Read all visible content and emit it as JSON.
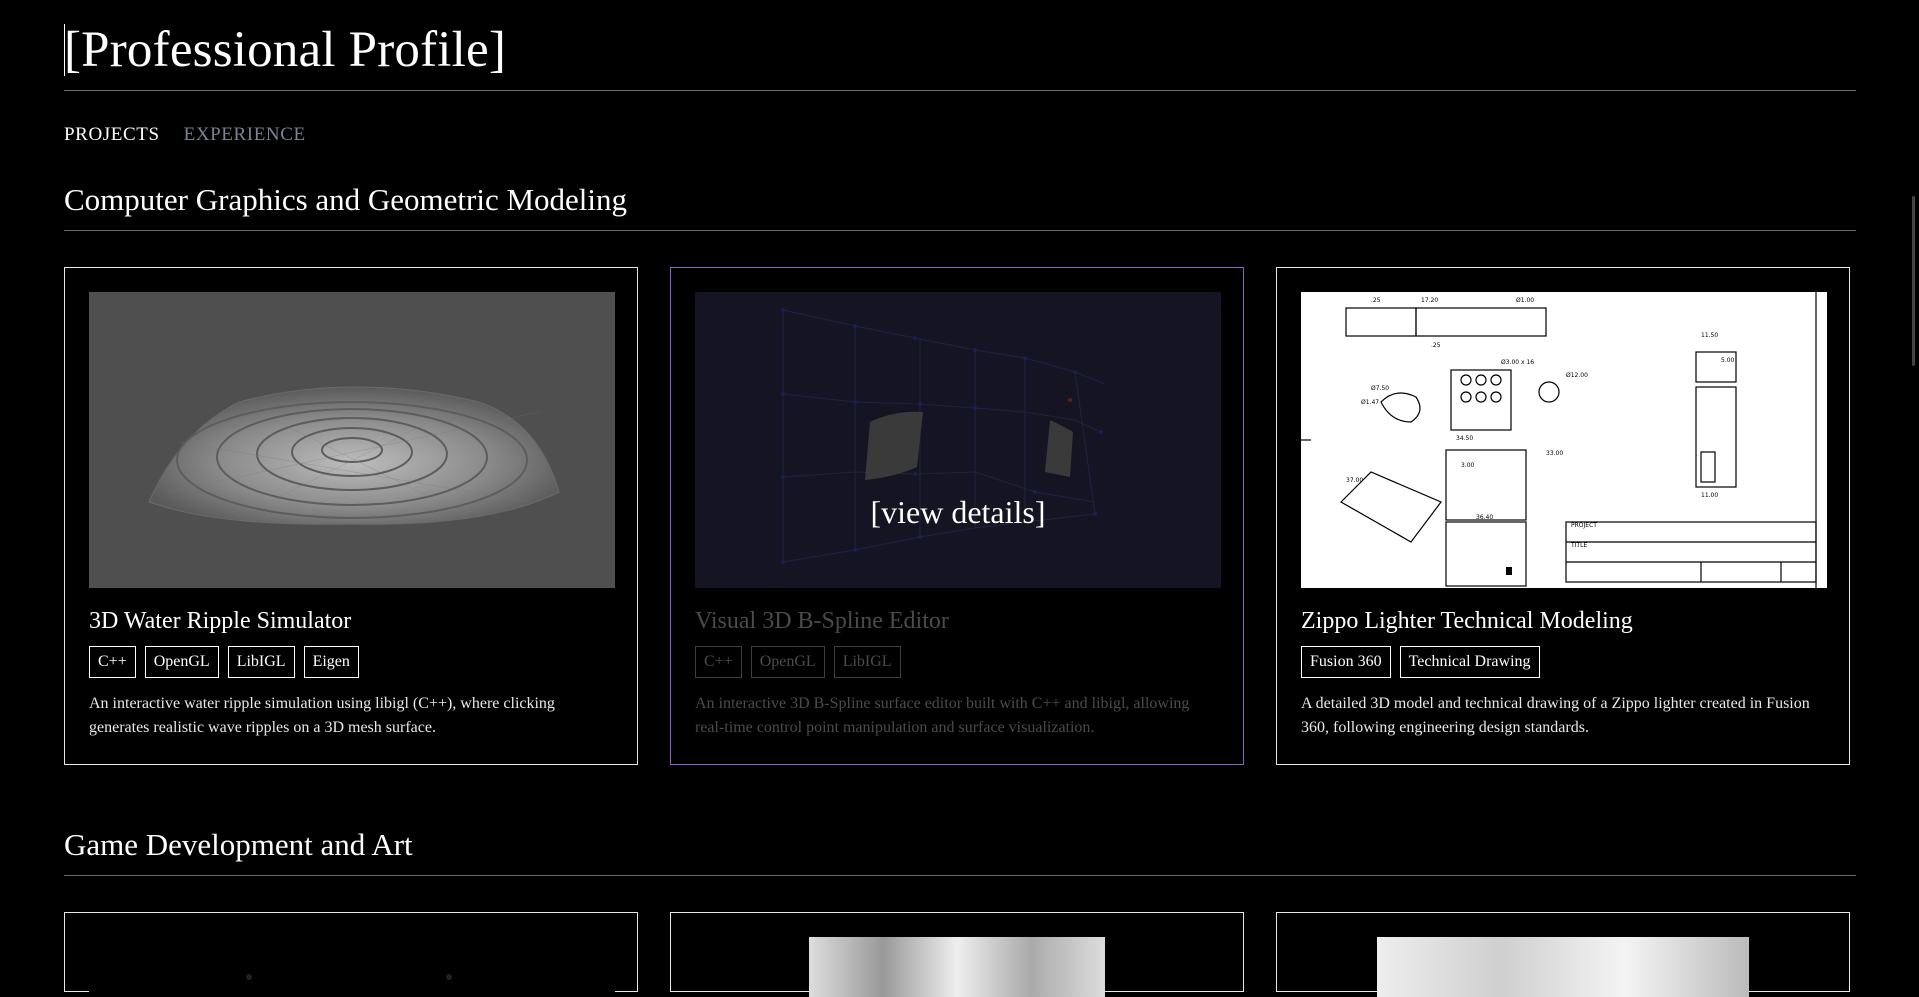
{
  "header": {
    "title": "[Professional Profile]"
  },
  "nav": {
    "tabs": [
      {
        "label": "PROJECTS"
      },
      {
        "label": "EXPERIENCE"
      }
    ]
  },
  "sections": [
    {
      "title": "Computer Graphics and Geometric Modeling",
      "cards": [
        {
          "title": "3D Water Ripple Simulator",
          "tags": [
            "C++",
            "OpenGL",
            "LibIGL",
            "Eigen"
          ],
          "description": "An interactive water ripple simulation using libigl (C++), where clicking generates realistic wave ripples on a 3D mesh surface."
        },
        {
          "title": "Visual 3D B-Spline Editor",
          "tags": [
            "C++",
            "OpenGL",
            "LibIGL"
          ],
          "description": "An interactive 3D B-Spline surface editor built with C++ and libigl, allowing real-time control point manipulation and surface visualization.",
          "overlay": "[view details]"
        },
        {
          "title": "Zippo Lighter Technical Modeling",
          "tags": [
            "Fusion 360",
            "Technical Drawing"
          ],
          "description": "A detailed 3D model and technical drawing of a Zippo lighter created in Fusion 360, following engineering design standards."
        }
      ]
    },
    {
      "title": "Game Development and Art"
    }
  ],
  "colors": {
    "background": "#000000",
    "hover_border": "#8a62c9",
    "inactive_tab": "#7b8192"
  }
}
